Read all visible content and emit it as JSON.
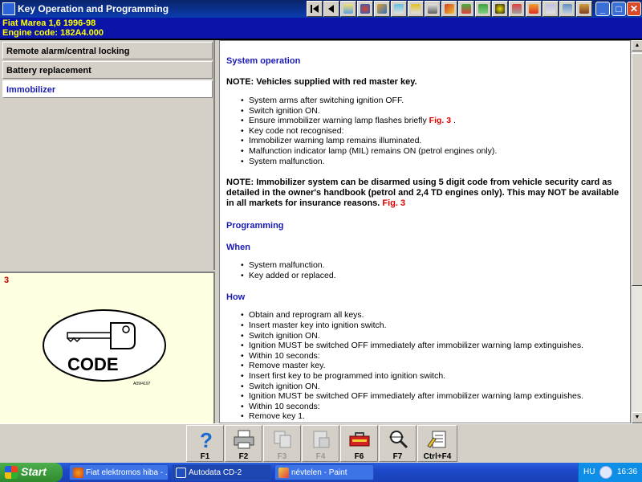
{
  "window": {
    "title": "Key Operation and Programming",
    "vehicle_line1": "Fiat   Marea 1,6   1996-98",
    "vehicle_line2": "Engine code: 182A4.000",
    "toolbar_icons": [
      "first-page-icon",
      "previous-page-icon",
      "tool-icon-1",
      "tool-icon-2",
      "tool-icon-3",
      "tool-icon-4",
      "tool-icon-5",
      "tool-icon-6",
      "tool-icon-7",
      "tool-icon-8",
      "tool-icon-9",
      "tool-icon-10",
      "tool-icon-11",
      "tool-icon-12",
      "tool-icon-13"
    ],
    "controls": {
      "minimize": "_",
      "maximize": "□",
      "close": "✕"
    }
  },
  "sidebar": {
    "items": [
      {
        "label": "Remote alarm/central locking"
      },
      {
        "label": "Battery replacement"
      },
      {
        "label": "Immobilizer"
      }
    ]
  },
  "figure": {
    "number": "3",
    "code_text": "CODE",
    "ref_code": "A09/4197"
  },
  "content": {
    "heading_system_operation": "System operation",
    "note1": "NOTE: Vehicles supplied with red master key.",
    "list1": [
      "System arms after switching ignition OFF.",
      "Switch ignition ON.",
      "Ensure immobilizer warning lamp flashes briefly ",
      "Key code not recognised:",
      "Immobilizer warning lamp remains illuminated.",
      "Malfunction indicator lamp (MIL) remains ON (petrol engines only).",
      "System malfunction."
    ],
    "list1_fig_ref": "Fig. 3",
    "list1_fig_ref_suffix": " .",
    "note2": "NOTE: Immobilizer system can be disarmed using 5 digit code from vehicle security card as detailed in the owner's handbook (petrol and 2,4 TD engines only). This may NOT be available in all markets for insurance reasons. ",
    "note2_fig_ref": "Fig. 3",
    "heading_programming": "Programming",
    "heading_when": "When",
    "list_when": [
      "System malfunction.",
      "Key added or replaced."
    ],
    "heading_how": "How",
    "list_how": [
      "Obtain and reprogram all keys.",
      "Insert master key into ignition switch.",
      "Switch ignition ON.",
      "Ignition MUST be switched OFF immediately after immobilizer warning lamp extinguishes.",
      "Within 10 seconds:",
      "Remove master key.",
      "Insert first key to be programmed into ignition switch.",
      "Switch ignition ON.",
      "Ignition MUST be switched OFF immediately after immobilizer warning lamp extinguishes.",
      "Within 10 seconds:",
      "Remove key 1."
    ]
  },
  "fkeys": [
    {
      "label": "F1",
      "icon": "help-icon",
      "enabled": true
    },
    {
      "label": "F2",
      "icon": "print-icon",
      "enabled": true
    },
    {
      "label": "F3",
      "icon": "copy-icon",
      "enabled": false
    },
    {
      "label": "F4",
      "icon": "paste-icon",
      "enabled": false
    },
    {
      "label": "F6",
      "icon": "toolbox-icon",
      "enabled": true
    },
    {
      "label": "F7",
      "icon": "zoom-icon",
      "enabled": true
    },
    {
      "label": "Ctrl+F4",
      "icon": "notes-icon",
      "enabled": true
    }
  ],
  "taskbar": {
    "start": "Start",
    "tasks": [
      {
        "label": "Fiat elektromos hiba - ..."
      },
      {
        "label": "Autodata CD-2"
      },
      {
        "label": "névtelen - Paint"
      }
    ],
    "lang": "HU",
    "clock": "16:36"
  }
}
